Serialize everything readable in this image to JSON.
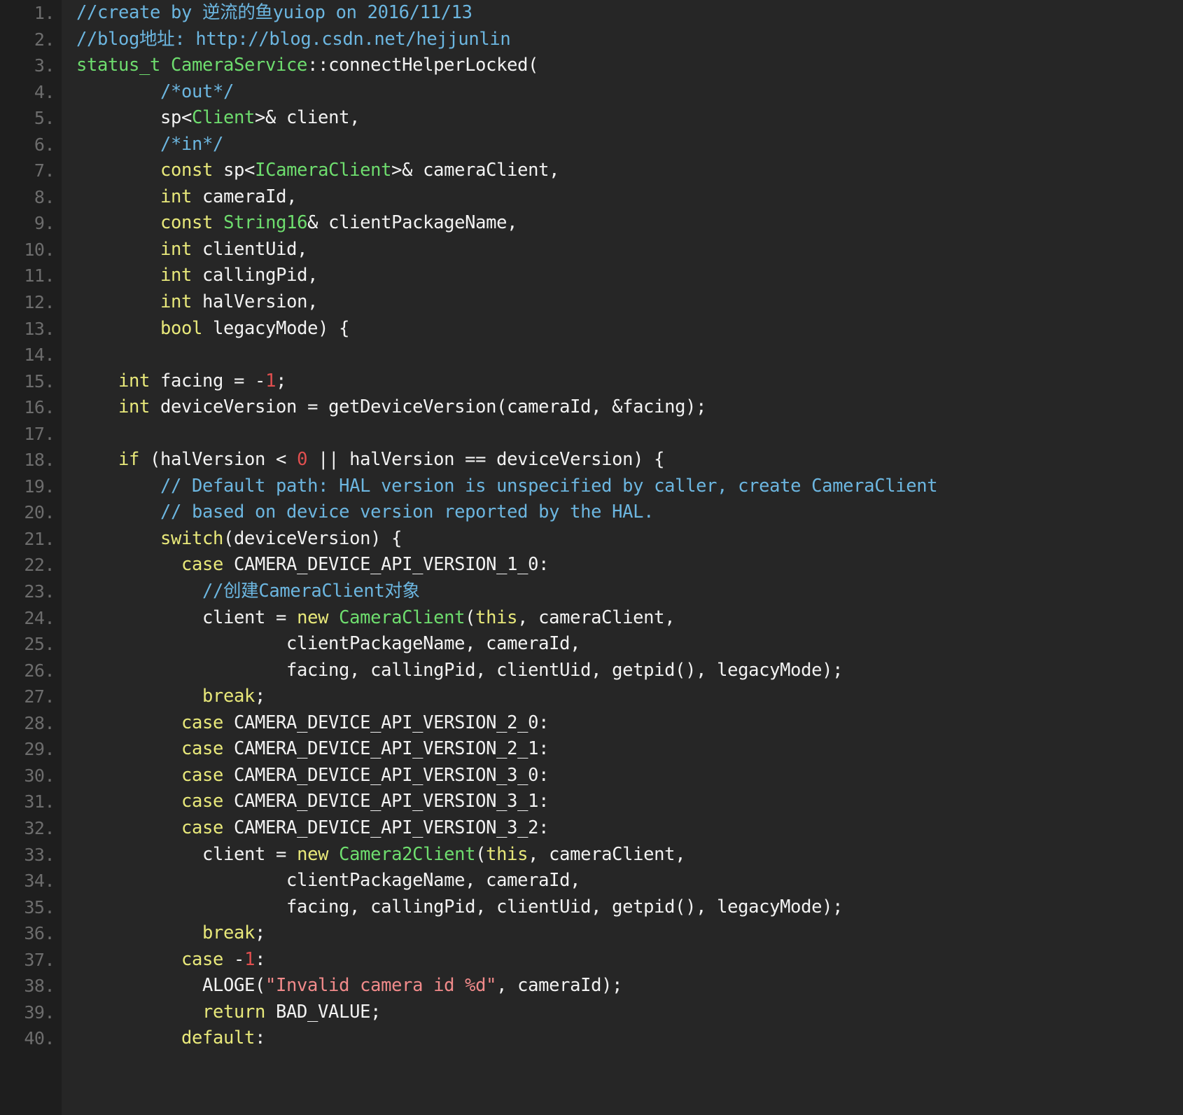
{
  "editor": {
    "theme_name": "dark-code-theme",
    "background": "#262626",
    "gutter_background": "#1e1e1e",
    "line_number_color": "#6d6d6d",
    "first_visible_line": 1,
    "last_visible_line": 40,
    "total_visible_lines": 40,
    "language": "cpp",
    "colors": {
      "comment": "#6cb6e0",
      "keyword": "#e8e87a",
      "type": "#6edd6e",
      "number": "#e04f4f",
      "string": "#f08a8a",
      "default": "#f2f2f2"
    }
  },
  "lines": [
    {
      "n": "1.",
      "tokens": [
        {
          "t": "//create by 逆流的鱼yuiop on 2016/11/13",
          "c": "cmt"
        }
      ]
    },
    {
      "n": "2.",
      "tokens": [
        {
          "t": "//blog地址: http://blog.csdn.net/hejjunlin",
          "c": "cmt"
        }
      ]
    },
    {
      "n": "3.",
      "tokens": [
        {
          "t": "status_t ",
          "c": "ty"
        },
        {
          "t": "CameraService",
          "c": "ty"
        },
        {
          "t": "::connectHelperLocked(",
          "c": "id"
        }
      ]
    },
    {
      "n": "4.",
      "tokens": [
        {
          "t": "        ",
          "c": "id"
        },
        {
          "t": "/*out*/",
          "c": "cmt"
        }
      ]
    },
    {
      "n": "5.",
      "tokens": [
        {
          "t": "        sp<",
          "c": "id"
        },
        {
          "t": "Client",
          "c": "ty"
        },
        {
          "t": ">& client,",
          "c": "id"
        }
      ]
    },
    {
      "n": "6.",
      "tokens": [
        {
          "t": "        ",
          "c": "id"
        },
        {
          "t": "/*in*/",
          "c": "cmt"
        }
      ]
    },
    {
      "n": "7.",
      "tokens": [
        {
          "t": "        ",
          "c": "id"
        },
        {
          "t": "const",
          "c": "kw"
        },
        {
          "t": " sp<",
          "c": "id"
        },
        {
          "t": "ICameraClient",
          "c": "ty"
        },
        {
          "t": ">& cameraClient,",
          "c": "id"
        }
      ]
    },
    {
      "n": "8.",
      "tokens": [
        {
          "t": "        ",
          "c": "id"
        },
        {
          "t": "int",
          "c": "kw"
        },
        {
          "t": " cameraId,",
          "c": "id"
        }
      ]
    },
    {
      "n": "9.",
      "tokens": [
        {
          "t": "        ",
          "c": "id"
        },
        {
          "t": "const",
          "c": "kw"
        },
        {
          "t": " ",
          "c": "id"
        },
        {
          "t": "String16",
          "c": "ty"
        },
        {
          "t": "& clientPackageName,",
          "c": "id"
        }
      ]
    },
    {
      "n": "10.",
      "tokens": [
        {
          "t": "        ",
          "c": "id"
        },
        {
          "t": "int",
          "c": "kw"
        },
        {
          "t": " clientUid,",
          "c": "id"
        }
      ]
    },
    {
      "n": "11.",
      "tokens": [
        {
          "t": "        ",
          "c": "id"
        },
        {
          "t": "int",
          "c": "kw"
        },
        {
          "t": " callingPid,",
          "c": "id"
        }
      ]
    },
    {
      "n": "12.",
      "tokens": [
        {
          "t": "        ",
          "c": "id"
        },
        {
          "t": "int",
          "c": "kw"
        },
        {
          "t": " halVersion,",
          "c": "id"
        }
      ]
    },
    {
      "n": "13.",
      "tokens": [
        {
          "t": "        ",
          "c": "id"
        },
        {
          "t": "bool",
          "c": "kw"
        },
        {
          "t": " legacyMode) {",
          "c": "id"
        }
      ]
    },
    {
      "n": "14.",
      "tokens": []
    },
    {
      "n": "15.",
      "tokens": [
        {
          "t": "    ",
          "c": "id"
        },
        {
          "t": "int",
          "c": "kw"
        },
        {
          "t": " facing = -",
          "c": "id"
        },
        {
          "t": "1",
          "c": "num"
        },
        {
          "t": ";",
          "c": "id"
        }
      ]
    },
    {
      "n": "16.",
      "tokens": [
        {
          "t": "    ",
          "c": "id"
        },
        {
          "t": "int",
          "c": "kw"
        },
        {
          "t": " deviceVersion = getDeviceVersion(cameraId, &facing);",
          "c": "id"
        }
      ]
    },
    {
      "n": "17.",
      "tokens": []
    },
    {
      "n": "18.",
      "tokens": [
        {
          "t": "    ",
          "c": "id"
        },
        {
          "t": "if",
          "c": "kw"
        },
        {
          "t": " (halVersion < ",
          "c": "id"
        },
        {
          "t": "0",
          "c": "num"
        },
        {
          "t": " || halVersion == deviceVersion) {",
          "c": "id"
        }
      ]
    },
    {
      "n": "19.",
      "tokens": [
        {
          "t": "        ",
          "c": "id"
        },
        {
          "t": "// Default path: HAL version is unspecified by caller, create CameraClient",
          "c": "cmt"
        }
      ]
    },
    {
      "n": "20.",
      "tokens": [
        {
          "t": "        ",
          "c": "id"
        },
        {
          "t": "// based on device version reported by the HAL.",
          "c": "cmt"
        }
      ]
    },
    {
      "n": "21.",
      "tokens": [
        {
          "t": "        ",
          "c": "id"
        },
        {
          "t": "switch",
          "c": "kw"
        },
        {
          "t": "(deviceVersion) {",
          "c": "id"
        }
      ]
    },
    {
      "n": "22.",
      "tokens": [
        {
          "t": "          ",
          "c": "id"
        },
        {
          "t": "case",
          "c": "kw"
        },
        {
          "t": " CAMERA_DEVICE_API_VERSION_1_0:",
          "c": "id"
        }
      ]
    },
    {
      "n": "23.",
      "tokens": [
        {
          "t": "            ",
          "c": "id"
        },
        {
          "t": "//创建CameraClient对象",
          "c": "cmt"
        }
      ]
    },
    {
      "n": "24.",
      "tokens": [
        {
          "t": "            client = ",
          "c": "id"
        },
        {
          "t": "new",
          "c": "kw"
        },
        {
          "t": " ",
          "c": "id"
        },
        {
          "t": "CameraClient",
          "c": "ty"
        },
        {
          "t": "(",
          "c": "id"
        },
        {
          "t": "this",
          "c": "kw"
        },
        {
          "t": ", cameraClient,",
          "c": "id"
        }
      ]
    },
    {
      "n": "25.",
      "tokens": [
        {
          "t": "                    clientPackageName, cameraId,",
          "c": "id"
        }
      ]
    },
    {
      "n": "26.",
      "tokens": [
        {
          "t": "                    facing, callingPid, clientUid, getpid(), legacyMode);",
          "c": "id"
        }
      ]
    },
    {
      "n": "27.",
      "tokens": [
        {
          "t": "            ",
          "c": "id"
        },
        {
          "t": "break",
          "c": "kw"
        },
        {
          "t": ";",
          "c": "id"
        }
      ]
    },
    {
      "n": "28.",
      "tokens": [
        {
          "t": "          ",
          "c": "id"
        },
        {
          "t": "case",
          "c": "kw"
        },
        {
          "t": " CAMERA_DEVICE_API_VERSION_2_0:",
          "c": "id"
        }
      ]
    },
    {
      "n": "29.",
      "tokens": [
        {
          "t": "          ",
          "c": "id"
        },
        {
          "t": "case",
          "c": "kw"
        },
        {
          "t": " CAMERA_DEVICE_API_VERSION_2_1:",
          "c": "id"
        }
      ]
    },
    {
      "n": "30.",
      "tokens": [
        {
          "t": "          ",
          "c": "id"
        },
        {
          "t": "case",
          "c": "kw"
        },
        {
          "t": " CAMERA_DEVICE_API_VERSION_3_0:",
          "c": "id"
        }
      ]
    },
    {
      "n": "31.",
      "tokens": [
        {
          "t": "          ",
          "c": "id"
        },
        {
          "t": "case",
          "c": "kw"
        },
        {
          "t": " CAMERA_DEVICE_API_VERSION_3_1:",
          "c": "id"
        }
      ]
    },
    {
      "n": "32.",
      "tokens": [
        {
          "t": "          ",
          "c": "id"
        },
        {
          "t": "case",
          "c": "kw"
        },
        {
          "t": " CAMERA_DEVICE_API_VERSION_3_2:",
          "c": "id"
        }
      ]
    },
    {
      "n": "33.",
      "tokens": [
        {
          "t": "            client = ",
          "c": "id"
        },
        {
          "t": "new",
          "c": "kw"
        },
        {
          "t": " ",
          "c": "id"
        },
        {
          "t": "Camera2Client",
          "c": "ty"
        },
        {
          "t": "(",
          "c": "id"
        },
        {
          "t": "this",
          "c": "kw"
        },
        {
          "t": ", cameraClient,",
          "c": "id"
        }
      ]
    },
    {
      "n": "34.",
      "tokens": [
        {
          "t": "                    clientPackageName, cameraId,",
          "c": "id"
        }
      ]
    },
    {
      "n": "35.",
      "tokens": [
        {
          "t": "                    facing, callingPid, clientUid, getpid(), legacyMode);",
          "c": "id"
        }
      ]
    },
    {
      "n": "36.",
      "tokens": [
        {
          "t": "            ",
          "c": "id"
        },
        {
          "t": "break",
          "c": "kw"
        },
        {
          "t": ";",
          "c": "id"
        }
      ]
    },
    {
      "n": "37.",
      "tokens": [
        {
          "t": "          ",
          "c": "id"
        },
        {
          "t": "case",
          "c": "kw"
        },
        {
          "t": " -",
          "c": "id"
        },
        {
          "t": "1",
          "c": "num"
        },
        {
          "t": ":",
          "c": "id"
        }
      ]
    },
    {
      "n": "38.",
      "tokens": [
        {
          "t": "            ALOGE(",
          "c": "id"
        },
        {
          "t": "\"Invalid camera id %d\"",
          "c": "str"
        },
        {
          "t": ", cameraId);",
          "c": "id"
        }
      ]
    },
    {
      "n": "39.",
      "tokens": [
        {
          "t": "            ",
          "c": "id"
        },
        {
          "t": "return",
          "c": "kw"
        },
        {
          "t": " BAD_VALUE;",
          "c": "id"
        }
      ]
    },
    {
      "n": "40.",
      "tokens": [
        {
          "t": "          ",
          "c": "id"
        },
        {
          "t": "default",
          "c": "kw"
        },
        {
          "t": ":",
          "c": "id"
        }
      ]
    }
  ]
}
